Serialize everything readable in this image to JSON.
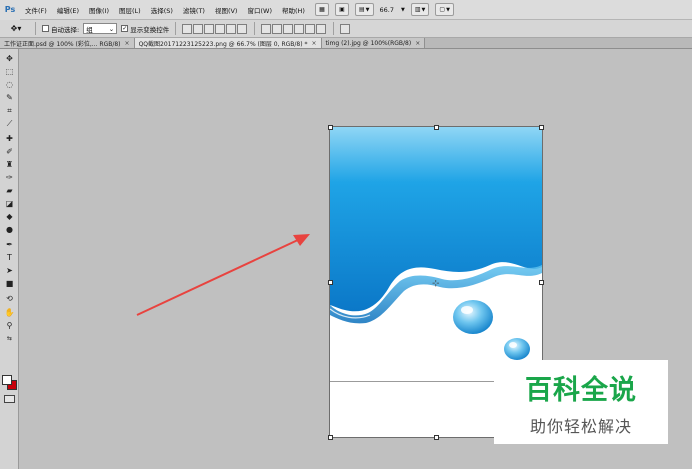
{
  "app": {
    "logo": "Ps"
  },
  "menu": [
    "文件(F)",
    "编辑(E)",
    "图像(I)",
    "图层(L)",
    "选择(S)",
    "滤镜(T)",
    "视图(V)",
    "窗口(W)",
    "帮助(H)"
  ],
  "menubar_right": {
    "zoom": "66.7",
    "icons": [
      "bridge-icon",
      "minibridge-icon",
      "view-extras-icon",
      "arrange-docs-icon",
      "screen-mode-icon"
    ]
  },
  "options": {
    "auto_select_label": "自动选择:",
    "auto_select_value": "组",
    "auto_select_checked": false,
    "show_transform_label": "显示变换控件",
    "show_transform_checked": true
  },
  "tabs": [
    {
      "label": "工作证正面.psd @ 100% (彩位,... RGB/8)",
      "close": "×",
      "active": false
    },
    {
      "label": "QQ截图20171223125223.png @ 66.7% (图层 0, RGB/8) *",
      "close": "×",
      "active": true
    },
    {
      "label": "timg (2).jpg @ 100%(RGB/8)",
      "close": "×",
      "active": false
    }
  ],
  "tools": [
    "move-tool",
    "marquee-tool",
    "lasso-tool",
    "quick-select-tool",
    "crop-tool",
    "eyedropper-tool",
    "healing-brush-tool",
    "brush-tool",
    "clone-stamp-tool",
    "history-brush-tool",
    "eraser-tool",
    "paint-bucket-tool",
    "blur-tool",
    "dodge-tool",
    "pen-tool",
    "type-tool",
    "path-select-tool",
    "shape-tool",
    "3d-rotate-tool",
    "hand-tool",
    "zoom-tool"
  ],
  "colors": {
    "foreground": "#ffffff",
    "background": "#c8000a",
    "canvas_bg": "#c0c0c0",
    "arrow": "#e8433f",
    "watermark_green": "#1aa64a"
  },
  "watermark": {
    "title": "百科全说",
    "subtitle": "助你轻松解决"
  }
}
